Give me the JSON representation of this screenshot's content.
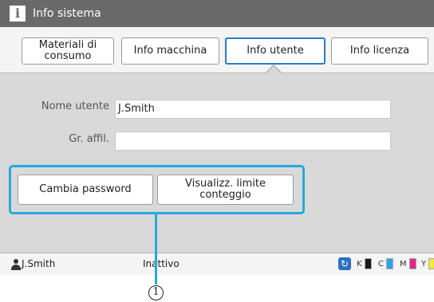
{
  "window": {
    "title": "Info sistema",
    "title_icon": "info-icon"
  },
  "tabs": [
    {
      "label": "Materiali di\nconsumo",
      "active": false
    },
    {
      "label": "Info macchina",
      "active": false
    },
    {
      "label": "Info utente",
      "active": true
    },
    {
      "label": "Info licenza",
      "active": false
    }
  ],
  "fields": {
    "user_name_label": "Nome utente",
    "user_name_value": "J.Smith",
    "group_label": "Gr. affil.",
    "group_value": ""
  },
  "buttons": {
    "change_password": "Cambia password",
    "view_limit": "Visualizz. limite\nconteggio"
  },
  "status": {
    "user": "J.Smith",
    "state": "Inattivo",
    "inks": [
      {
        "letter": "K",
        "color": "#1a1a1a"
      },
      {
        "letter": "C",
        "color": "#2aa7e0"
      },
      {
        "letter": "M",
        "color": "#e0268a"
      },
      {
        "letter": "Y",
        "color": "#f4e83a"
      }
    ]
  },
  "callout": {
    "number": "1"
  },
  "colors": {
    "accent": "#29a8dd",
    "active_tab": "#2c7bc6",
    "titlebar": "#6a6a6a"
  }
}
